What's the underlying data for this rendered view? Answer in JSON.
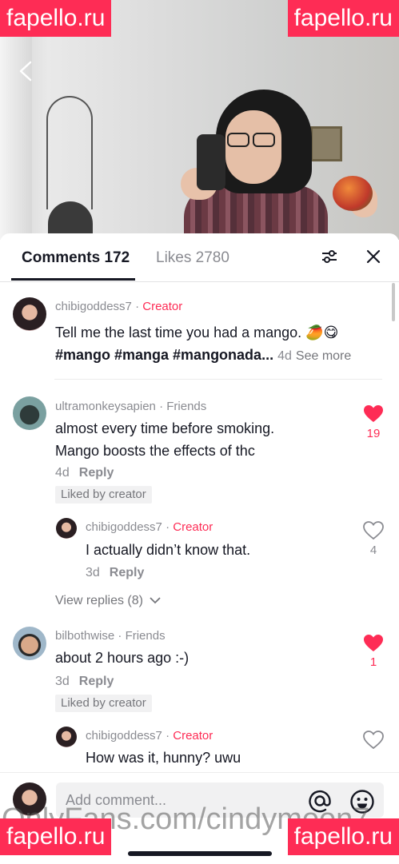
{
  "watermarks": {
    "top_left": "fapello.ru",
    "top_right": "fapello.ru",
    "bottom_left": "fapello.ru",
    "bottom_right": "fapello.ru",
    "overlay": "OnlyFans.com/cindymoon7"
  },
  "tabs": {
    "comments": "Comments 172",
    "likes": "Likes 2780"
  },
  "comments": [
    {
      "user": "chibigoddess7",
      "badge": "Creator",
      "text_line1": "Tell me the last time you had a mango. 🥭😋",
      "hashtags": "#mango #manga #mangonada...",
      "age": "4d",
      "see_more": "See more"
    },
    {
      "user": "ultramonkeysapien",
      "badge": "Friends",
      "text_line1": "almost every time before smoking.",
      "text_line2": "Mango boosts the effects of thc",
      "age": "4d",
      "reply": "Reply",
      "liked_by_creator": "Liked by creator",
      "likes": "19",
      "reply_item": {
        "user": "chibigoddess7",
        "badge": "Creator",
        "text": "I actually didn’t know that.",
        "age": "3d",
        "reply": "Reply",
        "likes": "4"
      },
      "view_replies": "View replies (8)"
    },
    {
      "user": "bilbothwise",
      "badge": "Friends",
      "text_line1": "about 2 hours ago :-)",
      "age": "3d",
      "reply": "Reply",
      "liked_by_creator": "Liked by creator",
      "likes": "1",
      "reply_item": {
        "user": "chibigoddess7",
        "badge": "Creator",
        "text": "How was it, hunny? uwu"
      }
    }
  ],
  "composer": {
    "placeholder": "Add comment..."
  },
  "colors": {
    "accent": "#fe2c55",
    "text": "#161823",
    "muted": "#8a8b91"
  },
  "icons": [
    "back-icon",
    "filter-icon",
    "close-icon",
    "heart-filled-icon",
    "heart-outline-icon",
    "chevron-down-icon",
    "at-icon",
    "emoji-icon"
  ]
}
